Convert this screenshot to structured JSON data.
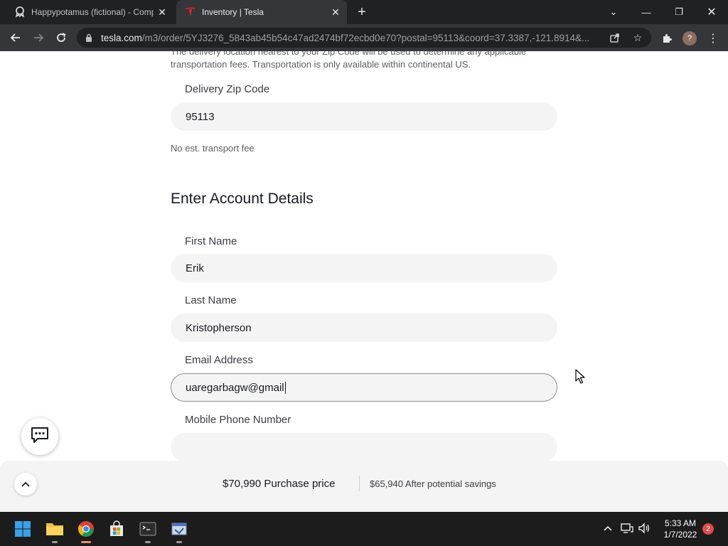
{
  "browser": {
    "tabs": [
      {
        "title": "Happypotamus (fictional) - Comp",
        "active": false
      },
      {
        "title": "Inventory | Tesla",
        "active": true
      }
    ],
    "url_domain": "tesla.com",
    "url_path": "/m3/order/5YJ3276_5843ab45b54c47ad2474bf72ecbd0e70?postal=95113&coord=37.3387,-121.8914&...",
    "profile_initial": "?"
  },
  "page": {
    "delivery_note": "The delivery location nearest to your Zip Code will be used to determine any applicable transportation fees. Transportation is only available within continental US.",
    "zip_label": "Delivery Zip Code",
    "zip_value": "95113",
    "transport_fee": "No est. transport fee",
    "section_title": "Enter Account Details",
    "first_name_label": "First Name",
    "first_name_value": "Erik",
    "last_name_label": "Last Name",
    "last_name_value": "Kristopherson",
    "email_label": "Email Address",
    "email_value": "uaregarbagw@gmail",
    "phone_label": "Mobile Phone Number",
    "phone_value": ""
  },
  "pricebar": {
    "purchase_price": "$70,990",
    "purchase_price_label": "Purchase price",
    "savings_price": "$65,940",
    "savings_label": "After potential savings"
  },
  "taskbar": {
    "time": "5:33 AM",
    "date": "1/7/2022",
    "notification_count": "2"
  },
  "colors": {
    "tesla_red": "#e82127",
    "field_bg": "#f4f4f4",
    "chrome_dark": "#202124"
  }
}
